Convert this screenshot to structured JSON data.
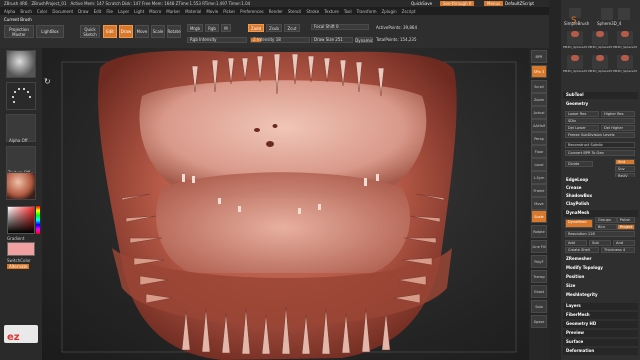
{
  "titlebar": {
    "app": "ZBrush 4R6",
    "project": "ZBrushProject_01",
    "stats": "Active Mem: 147  Scratch Disk: 147  Free Mem: 1648  ZTime:1.553  RTime:1.497  Timer:1.04",
    "quicksave": "QuickSave",
    "see_through": "See-through 0",
    "menus": "Menus",
    "script": "DefaultZScript"
  },
  "menus": [
    "Alpha",
    "Brush",
    "Color",
    "Document",
    "Draw",
    "Edit",
    "File",
    "Layer",
    "Light",
    "Macro",
    "Marker",
    "Material",
    "Movie",
    "Picker",
    "Preferences",
    "Render",
    "Stencil",
    "Stroke",
    "Texture",
    "Tool",
    "Transform",
    "Zplugin",
    "Zscript"
  ],
  "toolbar": {
    "current_brush": "Current Brush",
    "projection_master": "Projection Master",
    "lightbox": "LightBox",
    "quick_sketch": "Quick Sketch",
    "edit": "Edit",
    "draw": "Draw",
    "move": "Move",
    "scale": "Scale",
    "rotate": "Rotate",
    "mrgb": "Mrgb",
    "rgb": "Rgb",
    "m": "M",
    "zadd": "Zadd",
    "zsub": "Zsub",
    "zcut": "Zcut",
    "rgb_intensity": "Rgb Intensity",
    "z_intensity": "Z Intensity 18",
    "focal_shift": "Focal Shift 0",
    "draw_size": "Draw Size 251",
    "dynamic": "Dynamic",
    "active_points": "ActivePoints: 39,864",
    "total_points": "TotalPoints: 154,235"
  },
  "left_shelf": {
    "alpha_off": "Alpha Off",
    "texture_off": "Texture Off",
    "gradient": "Gradient",
    "switch_color": "SwitchColor",
    "alternate": "Alternate"
  },
  "right_shelf": {
    "icons": [
      "BPR",
      "SPix 3",
      "Scroll",
      "Zoom",
      "Actual",
      "AAHalf",
      "Persp",
      "Floor",
      "Local",
      "L.Sym",
      "Frame",
      "Move",
      "Scale",
      "Rotate",
      "Line Fill",
      "PolyF",
      "Transp",
      "Ghost",
      "Solo",
      "Xpose"
    ]
  },
  "tray": {
    "tool_name": "SimpleBrush",
    "tool_name2": "Sphere3D_4",
    "thumbs": [
      "PM3D_Sphere3D_4",
      "PM3D_Sphere3D_5",
      "PM3D_Sphere3D_6",
      "PM3D_Sphere3D_7",
      "PM3D_Sphere3D_8",
      "PM3D_Sphere3D_9"
    ],
    "subtool": "SubTool",
    "geometry": "Geometry",
    "lower_res": "Lower Res",
    "higher_res": "Higher Res",
    "sdiv": "SDiv",
    "del_lower": "Del Lower",
    "del_higher": "Del Higher",
    "freeze": "Freeze SubDivision Levels",
    "reconstruct": "Reconstruct Subdiv",
    "convert_bpr": "Convert BPR To Geo",
    "divide": "Divide",
    "smt": "Smt",
    "suv": "Suv",
    "reuv": "ReUV",
    "edgeloop": "EdgeLoop",
    "crease": "Crease",
    "shadowbox": "ShadowBox",
    "claypolish": "ClayPolish",
    "dynamesh_header": "DynaMesh",
    "dynamesh": "DynaMesh",
    "groups": "Groups",
    "polish": "Polish",
    "blur": "Blur",
    "project": "Project",
    "resolution": "Resolution 128",
    "add": "Add",
    "sub": "Sub",
    "and": "And",
    "create_shell": "Create Shell",
    "thickness": "Thickness 4",
    "zremesher": "ZRemesher",
    "modify_topology": "Modify Topology",
    "position": "Position",
    "size": "Size",
    "meshintegrity": "MeshIntegrity",
    "layers": "Layers",
    "fibermesh": "FiberMesh",
    "geometry_hd": "Geometry HD",
    "preview": "Preview",
    "surface": "Surface",
    "deformation": "Deformation"
  },
  "logo": "ez",
  "colors": {
    "accent": "#d8782b",
    "model": "#b75a48"
  }
}
